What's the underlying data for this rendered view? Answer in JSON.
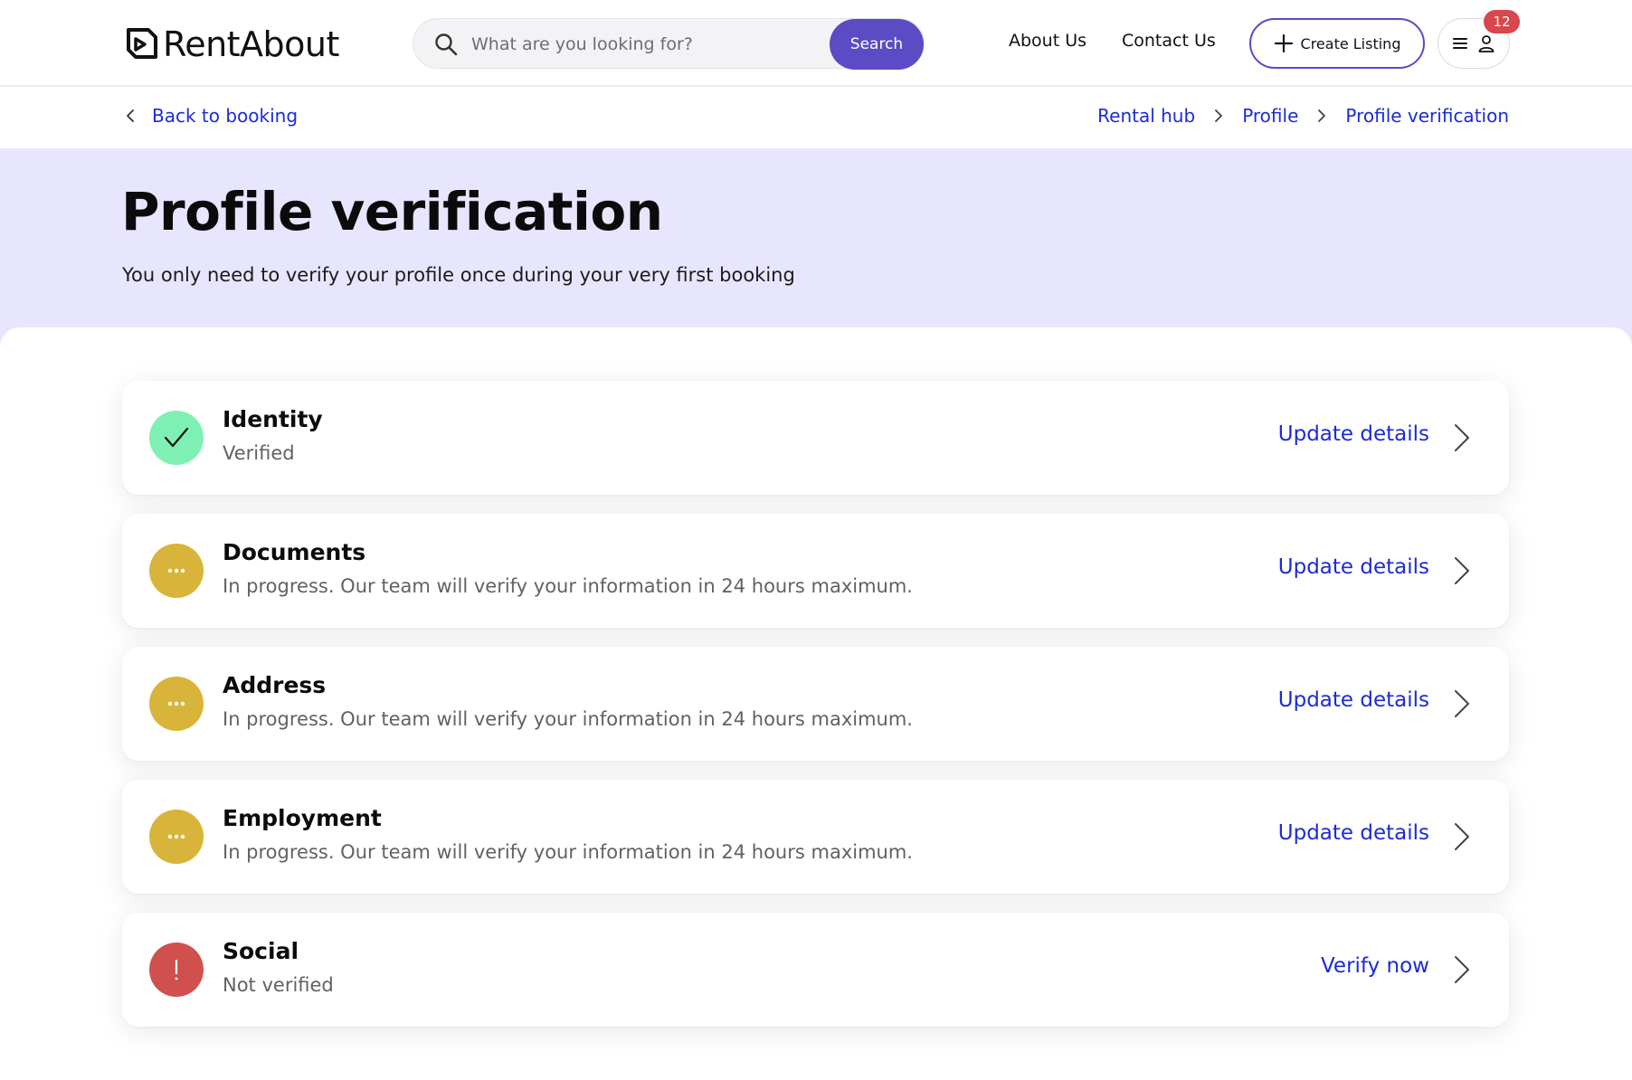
{
  "header": {
    "logo_text": "RentAbout",
    "search_placeholder": "What are you looking for?",
    "search_button": "Search",
    "nav": {
      "about": "About Us",
      "contact": "Contact Us"
    },
    "create_listing": "Create Listing",
    "notification_count": "12"
  },
  "subnav": {
    "back_label": "Back to booking",
    "breadcrumb": [
      "Rental hub",
      "Profile",
      "Profile verification"
    ]
  },
  "hero": {
    "title": "Profile verification",
    "subtitle": "You only need to verify your profile once during your very first booking"
  },
  "colors": {
    "accent": "#5b4bc4",
    "link": "#1c2bd6",
    "hero_bg": "#e8e6ff",
    "verified": "#7ff0b3",
    "in_progress": "#d8b43a",
    "not_verified": "#d0504e"
  },
  "items": [
    {
      "title": "Identity",
      "status": "verified",
      "icon": "check-icon",
      "description": "Verified",
      "action": "Update details"
    },
    {
      "title": "Documents",
      "status": "in-progress",
      "icon": "ellipsis-icon",
      "description": "In progress. Our team will verify your information in 24 hours maximum.",
      "action": "Update details"
    },
    {
      "title": "Address",
      "status": "in-progress",
      "icon": "ellipsis-icon",
      "description": "In progress. Our team will verify your information in 24 hours maximum.",
      "action": "Update details"
    },
    {
      "title": "Employment",
      "status": "in-progress",
      "icon": "ellipsis-icon",
      "description": "In progress. Our team will verify your information in 24 hours maximum.",
      "action": "Update details"
    },
    {
      "title": "Social",
      "status": "not-verified",
      "icon": "exclamation-icon",
      "description": "Not verified",
      "action": "Verify now"
    }
  ]
}
